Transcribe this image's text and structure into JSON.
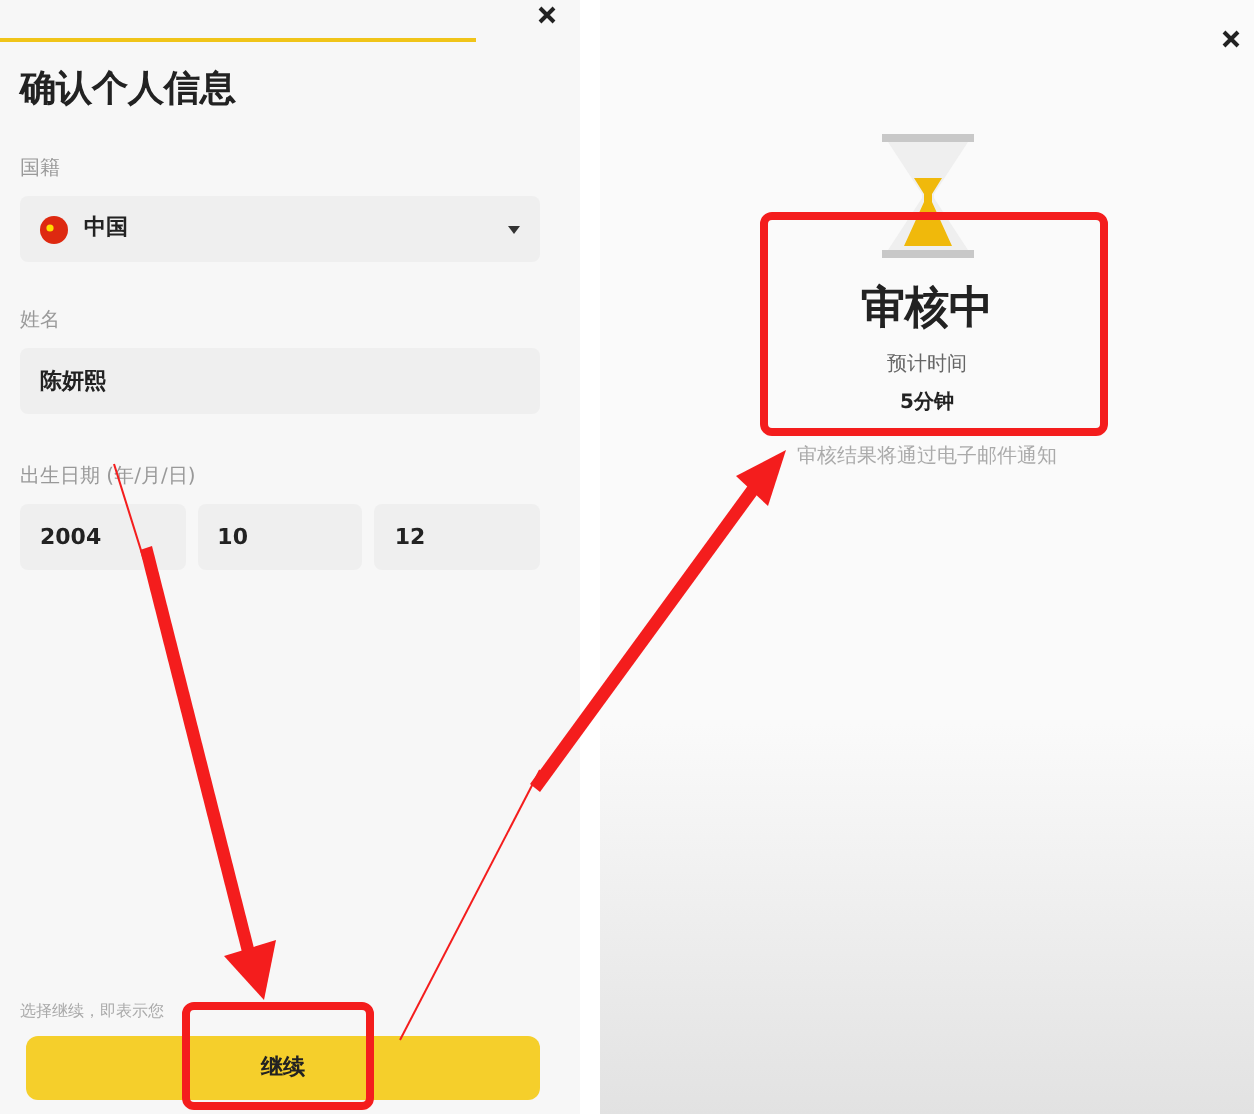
{
  "form_screen": {
    "title": "确认个人信息",
    "nationality": {
      "label": "国籍",
      "value": "中国"
    },
    "name": {
      "label": "姓名",
      "value": "陈妍熙"
    },
    "birth_date": {
      "label": "出生日期 (年/月/日)",
      "fields": [
        "2004",
        "10",
        "12"
      ]
    },
    "notice": "选择继续，即表示您",
    "continue_button": "继续"
  },
  "review_screen": {
    "title": "审核中",
    "eta_label": "预计时间",
    "eta": "5分钟",
    "notice": "审核结果将通过电子邮件通知"
  }
}
